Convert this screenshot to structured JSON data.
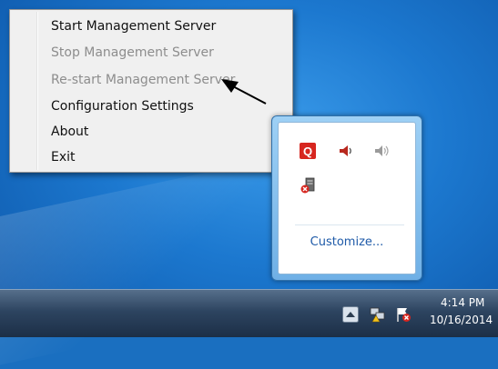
{
  "context_menu": {
    "items": [
      {
        "label": "Start Management Server",
        "enabled": true
      },
      {
        "label": "Stop Management Server",
        "enabled": false
      },
      {
        "label": "Re-start Management Server",
        "enabled": false
      },
      {
        "label": "Configuration Settings",
        "enabled": true
      },
      {
        "label": "About",
        "enabled": true
      },
      {
        "label": "Exit",
        "enabled": true
      }
    ]
  },
  "tray_flyout": {
    "icons": [
      "q-app-icon",
      "speaker-red-icon",
      "speaker-gray-icon",
      "server-error-icon"
    ],
    "customize_label": "Customize..."
  },
  "taskbar": {
    "tray_icons": [
      "show-hidden-icons-icon",
      "network-warning-icon",
      "action-center-flag-icon"
    ],
    "clock_time": "4:14 PM",
    "clock_date": "10/16/2014"
  },
  "colors": {
    "menu_bg": "#f0f0f0",
    "disabled_text": "#8d8d8d",
    "link_blue": "#1e5aa8",
    "q_red": "#d7261f"
  }
}
